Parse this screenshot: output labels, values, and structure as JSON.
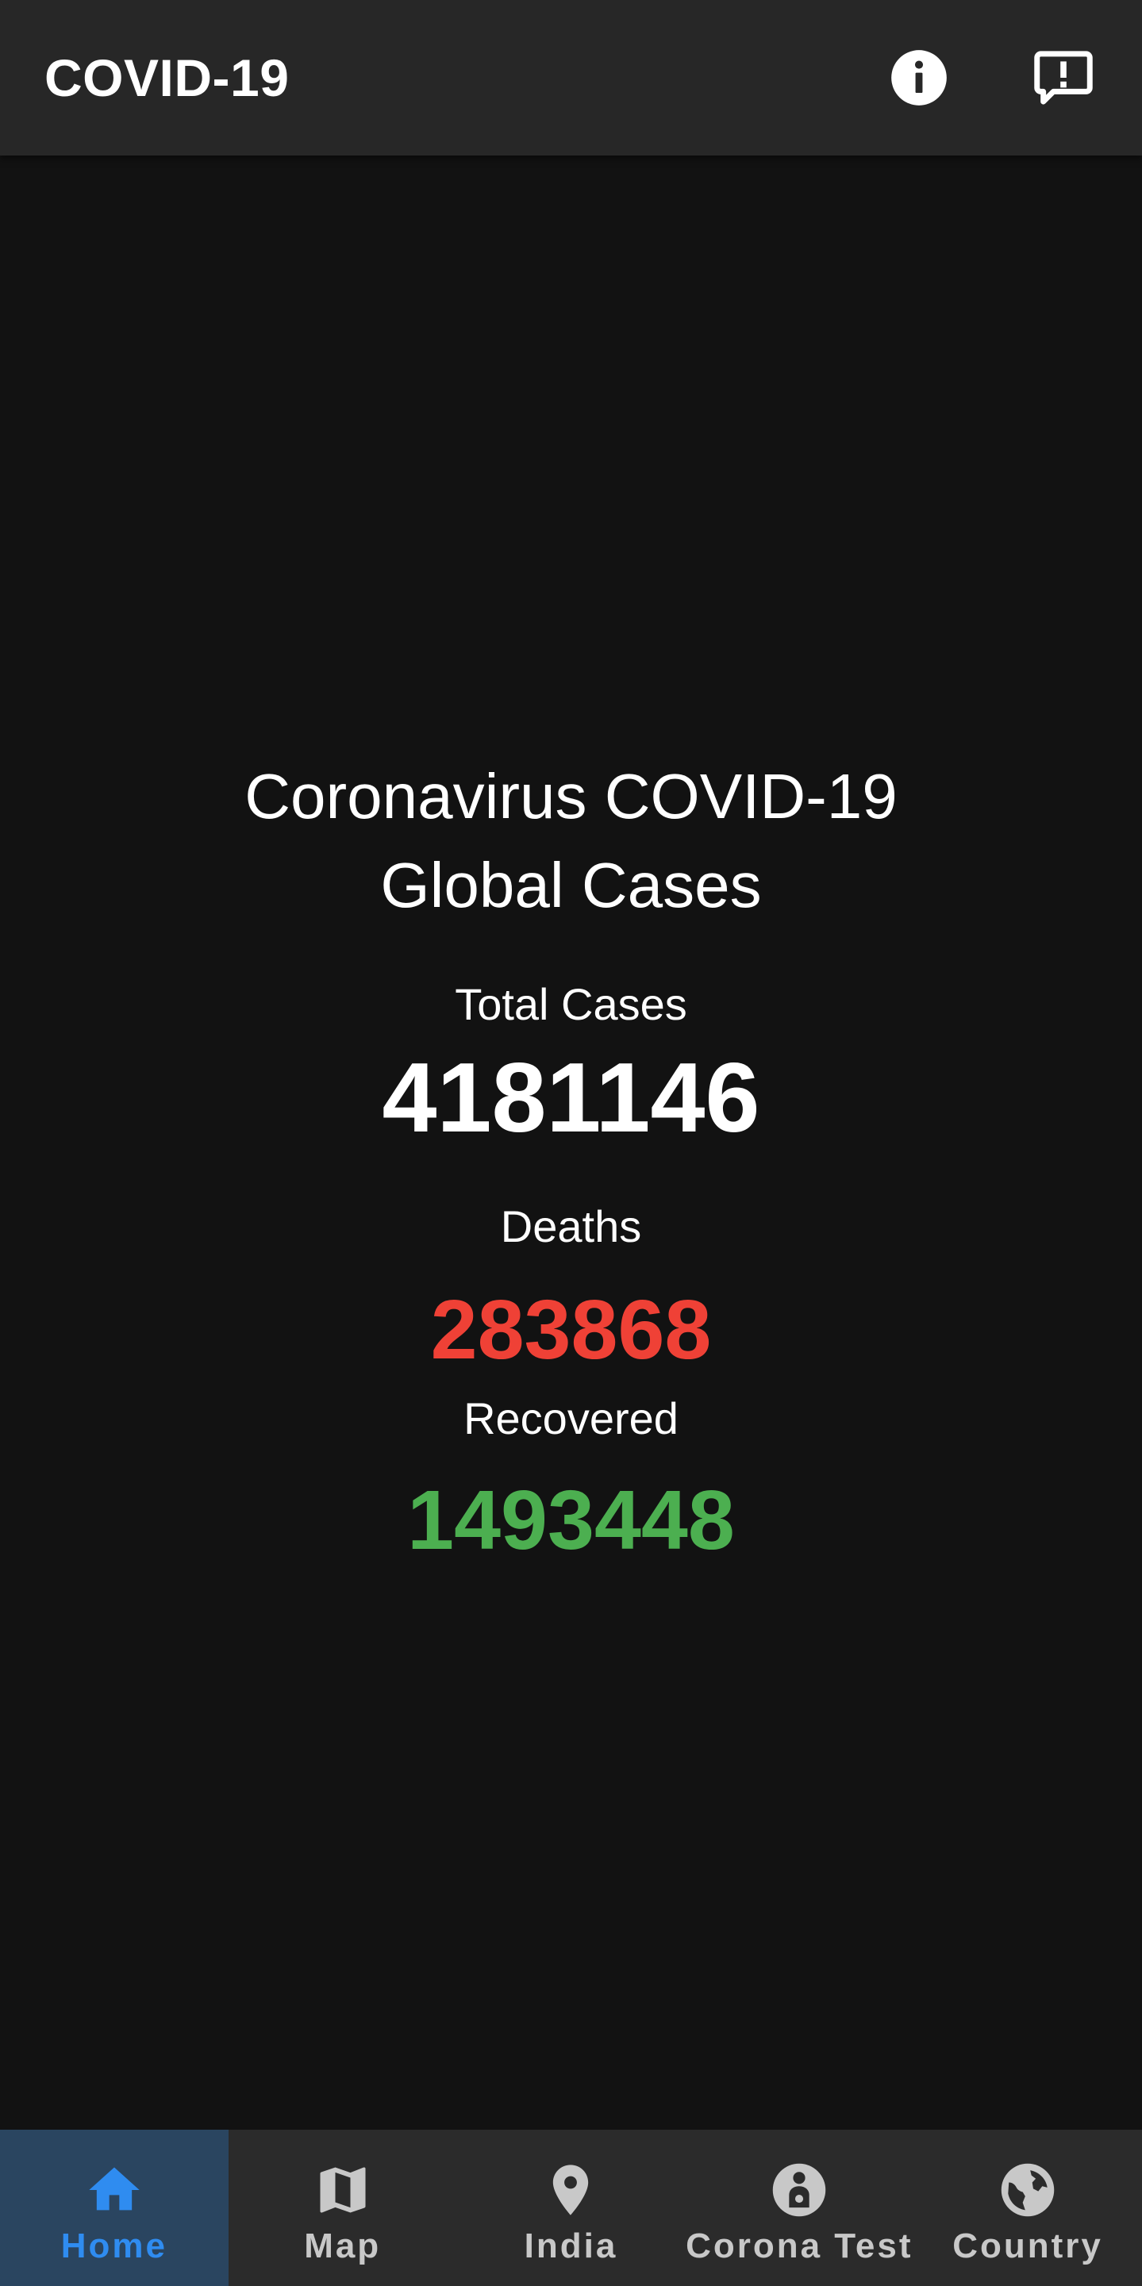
{
  "app_bar": {
    "title": "COVID-19",
    "actions": [
      {
        "icon": "info-icon"
      },
      {
        "icon": "feedback-icon"
      }
    ]
  },
  "main": {
    "headline_line1": "Coronavirus COVID-19",
    "headline_line2": "Global Cases",
    "total_label": "Total Cases",
    "total_value": "4181146",
    "deaths_label": "Deaths",
    "deaths_value": "283868",
    "recovered_label": "Recovered",
    "recovered_value": "1493448"
  },
  "colors": {
    "background": "#121212",
    "app_bar": "#272727",
    "deaths": "#EF4136",
    "recovered": "#4CAF50",
    "nav_active": "#2F8CF0",
    "nav_active_bg": "#2A4560",
    "nav_inactive": "#C8C8C8"
  },
  "bottom_nav": {
    "items": [
      {
        "label": "Home",
        "icon": "home-icon",
        "active": true
      },
      {
        "label": "Map",
        "icon": "map-icon",
        "active": false
      },
      {
        "label": "India",
        "icon": "location-pin-icon",
        "active": false
      },
      {
        "label": "Corona Test",
        "icon": "person-circle-icon",
        "active": false
      },
      {
        "label": "Country",
        "icon": "globe-icon",
        "active": false
      }
    ]
  }
}
